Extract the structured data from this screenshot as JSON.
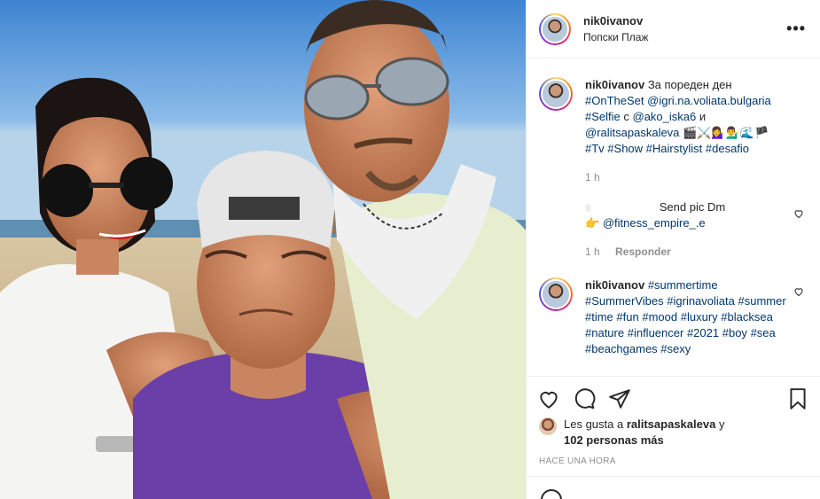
{
  "header": {
    "username": "nik0ivanov",
    "location": "Попски Плаж",
    "more_label": "•••"
  },
  "caption": {
    "username": "nik0ivanov",
    "text_1": "За пореден ден",
    "tag_onset": "#OnTheSet",
    "mention_igri": "@igri.na.voliata.bulgaria",
    "tag_selfie": "#Selfie",
    "text_c": "с",
    "mention_ako": "@ako_iska6",
    "text_i": "и",
    "mention_ralitsa": "@ralitsapaskaleva",
    "emojis": "🎬⚔️💁‍♀️💁‍♂️🌊🏴",
    "tag_tv": "#Tv",
    "tag_show": "#Show",
    "tag_hairstylist": "#Hairstylist",
    "tag_desafio": "#desafio",
    "time": "1 h"
  },
  "comment_1": {
    "blurred_prefix": "s",
    "text": "Send pic Dm",
    "pointer_emoji": "👉",
    "mention": "@fitness_empire_.e",
    "time": "1 h",
    "reply_label": "Responder"
  },
  "comment_2": {
    "username": "nik0ivanov",
    "tags": [
      "#summertime",
      "#SummerVibes",
      "#igrinavoliata",
      "#summer",
      "#time",
      "#fun",
      "#mood",
      "#luxury",
      "#blacksea",
      "#nature",
      "#influencer",
      "#2021",
      "#boy",
      "#sea",
      "#beachgames",
      "#sexy"
    ]
  },
  "likes": {
    "prefix": "Les gusta a",
    "user": "ralitsapaskaleva",
    "suffix": "y",
    "others": "102 personas más"
  },
  "timestamp": "HACE UNA HORA",
  "icons": {
    "like": "heart-outline-icon",
    "comment": "comment-bubble-icon",
    "share": "paper-plane-icon",
    "save": "bookmark-icon",
    "emoji": "emoji-icon"
  },
  "colors": {
    "link": "#00376b",
    "muted": "#8e8e8e",
    "text": "#262626",
    "shirt_purple": "#6a3fa8"
  }
}
